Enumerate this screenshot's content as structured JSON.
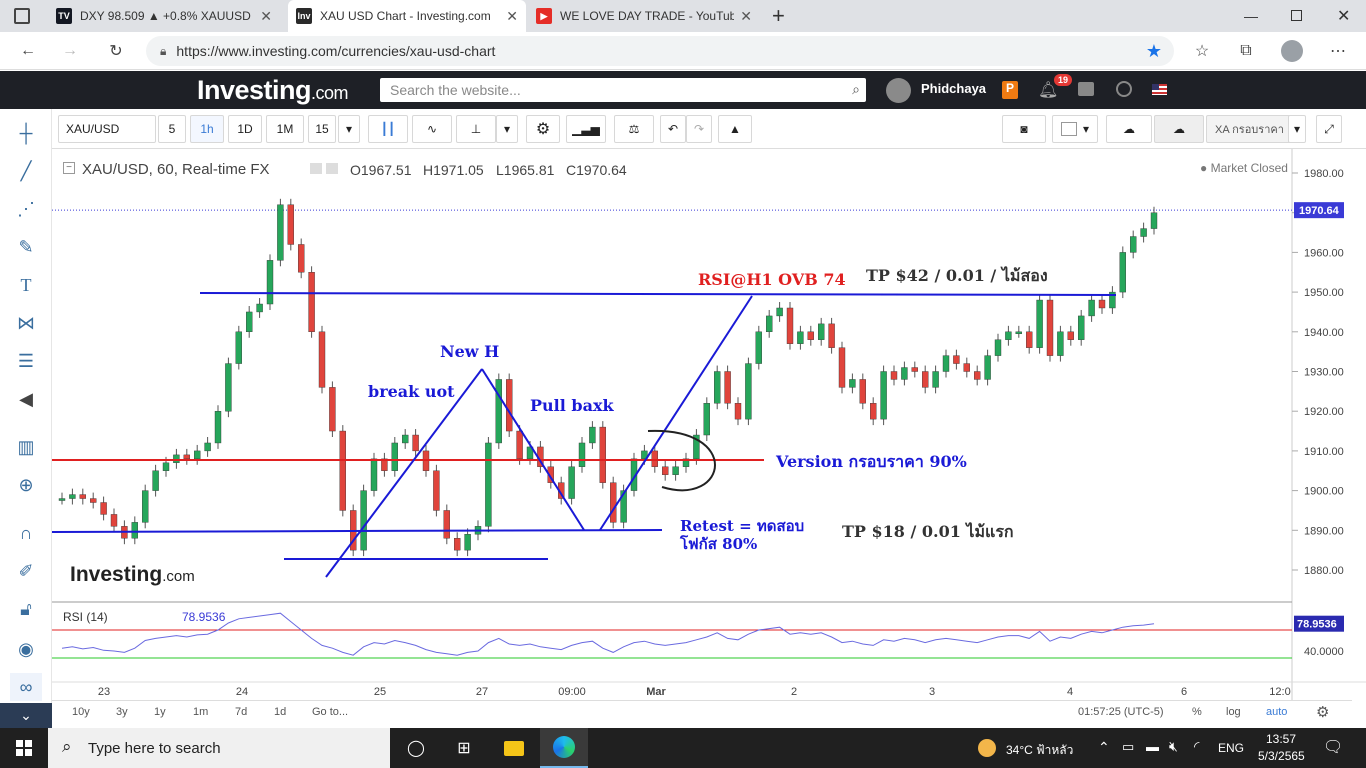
{
  "browser": {
    "tabs": [
      {
        "label": "DXY 98.509 ▲ +0.8% XAUUSD $",
        "icon": "tradingview-icon",
        "color": "#131722",
        "glyph": "TV"
      },
      {
        "label": "XAU USD Chart - Investing.com",
        "icon": "investing-icon",
        "color": "#2a2a2a",
        "glyph": "Inv"
      },
      {
        "label": "WE LOVE DAY TRADE - YouTube",
        "icon": "youtube-icon",
        "color": "#e52d27",
        "glyph": "▶"
      }
    ],
    "new_tab": "+",
    "url": "https://www.investing.com/currencies/xau-usd-chart"
  },
  "site": {
    "logo": "Investing",
    "logo_suffix": ".com",
    "search_placeholder": "Search the website...",
    "user": "Phidchaya",
    "notifications": "19"
  },
  "toolbar": {
    "symbol": "XAU/USD",
    "intervals": [
      "5",
      "1h",
      "1D",
      "1M",
      "15"
    ],
    "selected_interval": "1h",
    "right_label": "XA กรอบราคา"
  },
  "chart": {
    "header": "XAU/USD, 60, Real-time FX",
    "ohlc": {
      "open": "O1967.51",
      "high": "H1971.05",
      "low": "L1965.81",
      "close": "C1970.64"
    },
    "market_status": "Market Closed",
    "last_price": "1970.64",
    "watermark": "Investing",
    "watermark_suffix": ".com",
    "price_axis": [
      "1980.00",
      "1970.00",
      "1960.00",
      "1950.00",
      "1940.00",
      "1930.00",
      "1920.00",
      "1910.00",
      "1900.00",
      "1890.00",
      "1880.00"
    ],
    "time_axis": [
      "23",
      "24",
      "25",
      "27",
      "09:00",
      "Mar",
      "2",
      "3",
      "4",
      "6",
      "12:0"
    ],
    "rsi": {
      "label": "RSI (14)",
      "value": "78.9536",
      "axis": "40.0000",
      "tag": "78.9536"
    },
    "annotations": {
      "break": "break uot",
      "newh": "New H",
      "pull": "Pull baxk",
      "rsi": "RSI@H1 OVB 74",
      "tp42": "TP $42 / 0.01 / ไม้สอง",
      "version": "Version กรอบราคา 90%",
      "retest1": "Retest = ทดสอบ",
      "retest2": "โฟกัส 80%",
      "tp18": "TP $18 / 0.01 ไม้แรก"
    }
  },
  "bottom": {
    "ranges": [
      "10y",
      "3y",
      "1y",
      "1m",
      "7d",
      "1d",
      "Go to..."
    ],
    "time": "01:57:25 (UTC-5)",
    "pct": "%",
    "log": "log",
    "auto": "auto"
  },
  "taskbar": {
    "search": "Type here to search",
    "weather": "34°C ฟ้าหลัว",
    "lang": "ENG",
    "clock": "13:57",
    "date": "5/3/2565"
  }
}
